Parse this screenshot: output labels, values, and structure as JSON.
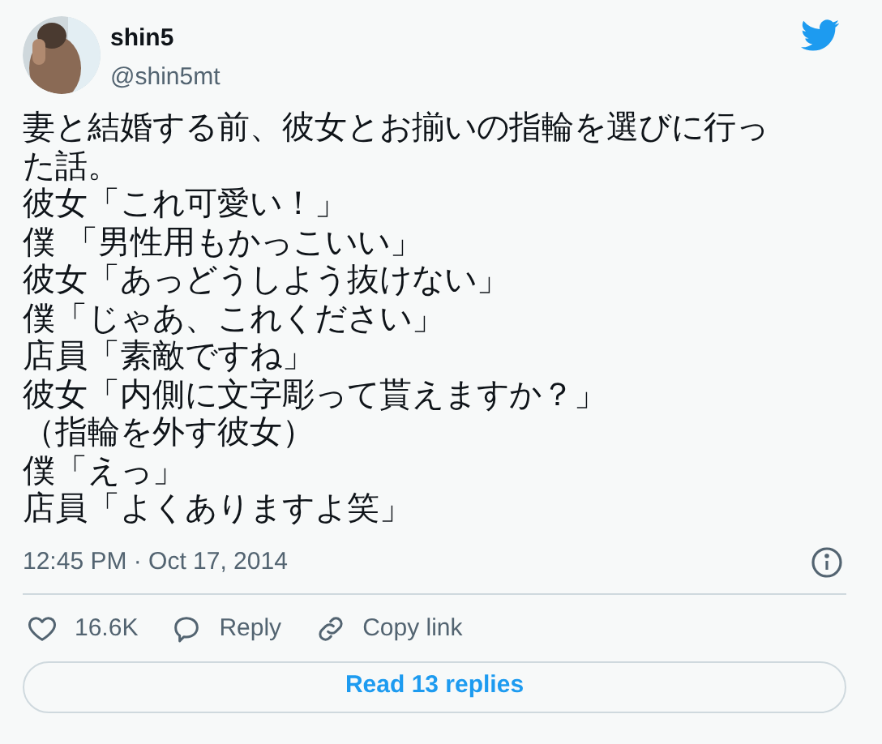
{
  "author": {
    "name": "shin5",
    "handle": "@shin5mt"
  },
  "tweet_lines": [
    "妻と結婚する前、彼女とお揃いの指輪を選びに行った話。",
    "彼女「これ可愛い！」",
    "僕 「男性用もかっこいい」",
    "彼女「あっどうしよう抜けない」",
    "僕「じゃあ、これください」",
    "店員「素敵ですね」",
    "彼女「内側に文字彫って貰えますか？」",
    "（指輪を外す彼女）",
    "僕「えっ」",
    "店員「よくありますよ笑」"
  ],
  "timestamp": "12:45 PM · Oct 17, 2014",
  "actions": [
    {
      "kind": "like",
      "label": "16.6K"
    },
    {
      "kind": "reply",
      "label": "Reply"
    },
    {
      "kind": "link",
      "label": "Copy link"
    }
  ],
  "read_replies_button": "Read 13 replies"
}
